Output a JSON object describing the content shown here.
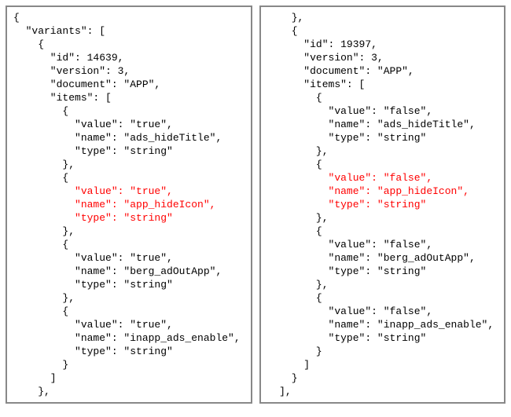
{
  "left": {
    "l0": "{",
    "l1": "  \"variants\": [",
    "l2": "    {",
    "l3": "      \"id\": 14639,",
    "l4": "      \"version\": 3,",
    "l5": "      \"document\": \"APP\",",
    "l6": "      \"items\": [",
    "l7": "        {",
    "l8": "          \"value\": \"true\",",
    "l9": "          \"name\": \"ads_hideTitle\",",
    "l10": "          \"type\": \"string\"",
    "l11": "        },",
    "l12": "        {",
    "l13": "          \"value\": \"true\",",
    "l14": "          \"name\": \"app_hideIcon\",",
    "l15": "          \"type\": \"string\"",
    "l16": "        },",
    "l17": "        {",
    "l18": "          \"value\": \"true\",",
    "l19": "          \"name\": \"berg_adOutApp\",",
    "l20": "          \"type\": \"string\"",
    "l21": "        },",
    "l22": "        {",
    "l23": "          \"value\": \"true\",",
    "l24": "          \"name\": \"inapp_ads_enable\",",
    "l25": "          \"type\": \"string\"",
    "l26": "        }",
    "l27": "      ]",
    "l28": "    },"
  },
  "right": {
    "l0": "    },",
    "l1": "    {",
    "l2": "      \"id\": 19397,",
    "l3": "      \"version\": 3,",
    "l4": "      \"document\": \"APP\",",
    "l5": "      \"items\": [",
    "l6": "        {",
    "l7": "          \"value\": \"false\",",
    "l8": "          \"name\": \"ads_hideTitle\",",
    "l9": "          \"type\": \"string\"",
    "l10": "        },",
    "l11": "        {",
    "l12": "          \"value\": \"false\",",
    "l13": "          \"name\": \"app_hideIcon\",",
    "l14": "          \"type\": \"string\"",
    "l15": "        },",
    "l16": "        {",
    "l17": "          \"value\": \"false\",",
    "l18": "          \"name\": \"berg_adOutApp\",",
    "l19": "          \"type\": \"string\"",
    "l20": "        },",
    "l21": "        {",
    "l22": "          \"value\": \"false\",",
    "l23": "          \"name\": \"inapp_ads_enable\",",
    "l24": "          \"type\": \"string\"",
    "l25": "        }",
    "l26": "      ]",
    "l27": "    }",
    "l28": "  ],"
  }
}
